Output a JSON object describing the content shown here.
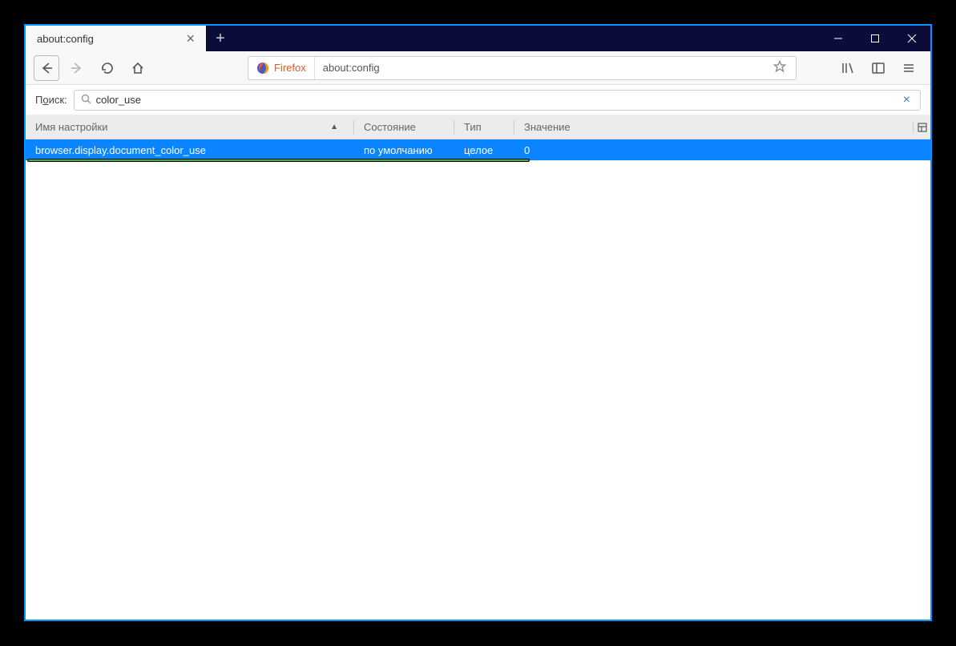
{
  "tab": {
    "title": "about:config"
  },
  "urlbar": {
    "identity_label": "Firefox",
    "url": "about:config"
  },
  "search": {
    "label_prefix": "П",
    "label_underlined": "о",
    "label_suffix": "иск:",
    "value": "color_use"
  },
  "columns": {
    "name": "Имя настройки",
    "status": "Состояние",
    "type": "Тип",
    "value": "Значение"
  },
  "row": {
    "name": "browser.display.document_color_use",
    "status": "по умолчанию",
    "type": "целое",
    "value": "0"
  }
}
